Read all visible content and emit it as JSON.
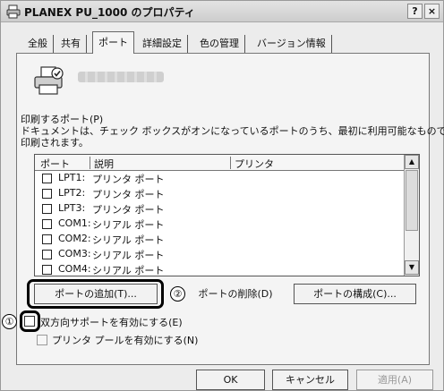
{
  "window": {
    "title": "PLANEX PU_1000 のプロパティ",
    "help_label": "?",
    "close_label": "×"
  },
  "tabs": [
    {
      "label": "全般",
      "active": false
    },
    {
      "label": "共有",
      "active": false
    },
    {
      "label": "ポート",
      "active": true
    },
    {
      "label": "詳細設定",
      "active": false
    },
    {
      "label": "色の管理",
      "active": false
    },
    {
      "label": "バージョン情報",
      "active": false
    }
  ],
  "ports_tab": {
    "section_label": "印刷するポート(P)",
    "description_line1": "ドキュメントは、チェック ボックスがオンになっているポートのうち、最初に利用可能なもので",
    "description_line2": "印刷されます。",
    "columns": {
      "port": "ポート",
      "description": "説明",
      "printer": "プリンタ"
    },
    "rows": [
      {
        "port": "LPT1:",
        "description": "プリンタ ポート",
        "checked": false
      },
      {
        "port": "LPT2:",
        "description": "プリンタ ポート",
        "checked": false
      },
      {
        "port": "LPT3:",
        "description": "プリンタ ポート",
        "checked": false
      },
      {
        "port": "COM1:",
        "description": "シリアル ポート",
        "checked": false
      },
      {
        "port": "COM2:",
        "description": "シリアル ポート",
        "checked": false
      },
      {
        "port": "COM3:",
        "description": "シリアル ポート",
        "checked": false
      },
      {
        "port": "COM4:",
        "description": "シリアル ポート",
        "checked": false
      }
    ],
    "scroll_up": "▲",
    "scroll_down": "▼",
    "add_port": "ポートの追加(T)...",
    "delete_port": "ポートの削除(D)",
    "configure_port": "ポートの構成(C)...",
    "bidirectional": {
      "label": "双方向サポートを有効にする(E)",
      "checked": false
    },
    "pooling": {
      "label": "プリンタ プールを有効にする(N)",
      "checked": false,
      "enabled": false
    },
    "callout_1": "①",
    "callout_2": "②"
  },
  "footer": {
    "ok": "OK",
    "cancel": "キャンセル",
    "apply": "適用(A)"
  }
}
